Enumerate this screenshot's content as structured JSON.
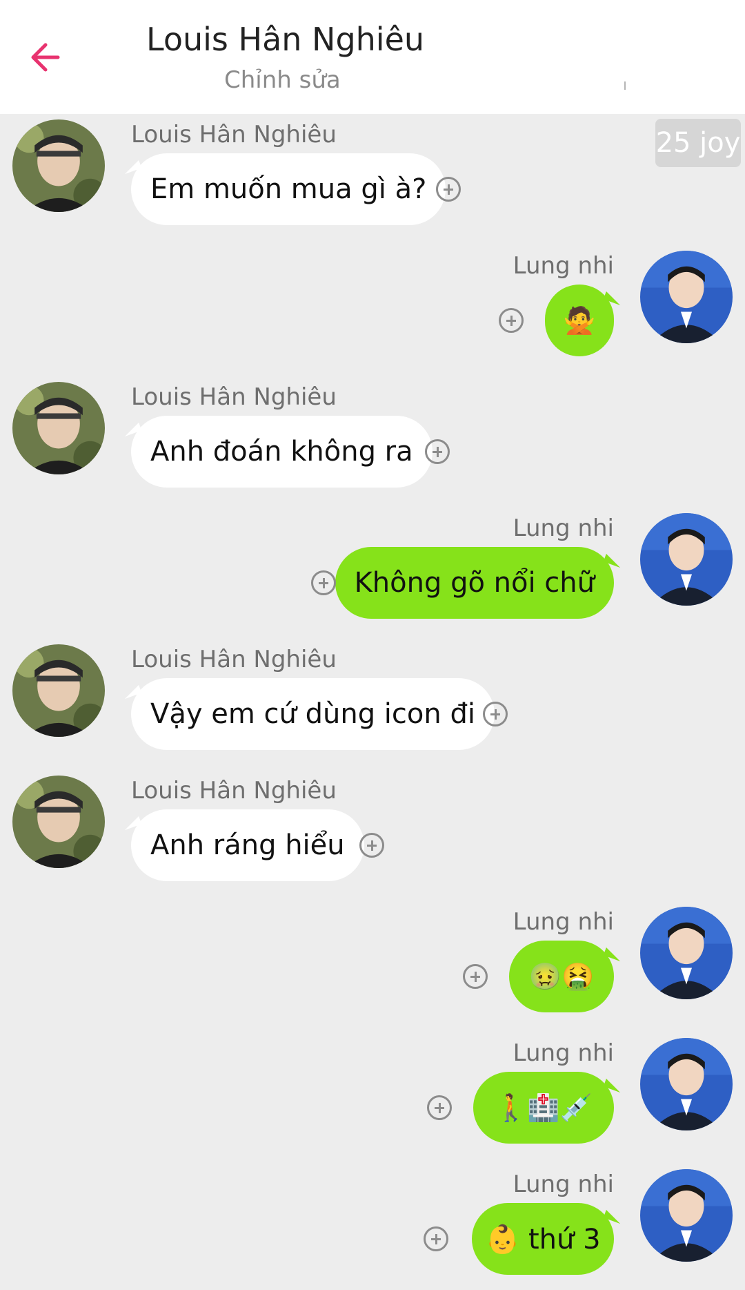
{
  "header": {
    "contact_name": "Louis Hân Nghiêu",
    "subtitle": "Chỉnh sửa"
  },
  "badge": {
    "joy_label": "25 joy"
  },
  "colors": {
    "accent": "#e8336f",
    "outgoing_bubble": "#86e21a",
    "incoming_bubble": "#ffffff",
    "background": "#ededed"
  },
  "messages": [
    {
      "sender": "Louis Hân Nghiêu",
      "direction": "in",
      "text": "Em muốn mua gì à?"
    },
    {
      "sender": "Lung nhi",
      "direction": "out",
      "text": "🙅"
    },
    {
      "sender": "Louis Hân Nghiêu",
      "direction": "in",
      "text": "Anh đoán không ra"
    },
    {
      "sender": "Lung nhi",
      "direction": "out",
      "text": "Không gõ nổi chữ"
    },
    {
      "sender": "Louis Hân Nghiêu",
      "direction": "in",
      "text": "Vậy em cứ dùng icon đi"
    },
    {
      "sender": "Louis Hân Nghiêu",
      "direction": "in",
      "text": "Anh ráng hiểu"
    },
    {
      "sender": "Lung nhi",
      "direction": "out",
      "text": "🤢🤮"
    },
    {
      "sender": "Lung nhi",
      "direction": "out",
      "text": "🚶🏥💉"
    },
    {
      "sender": "Lung nhi",
      "direction": "out",
      "text": "👶 thứ 3"
    }
  ]
}
